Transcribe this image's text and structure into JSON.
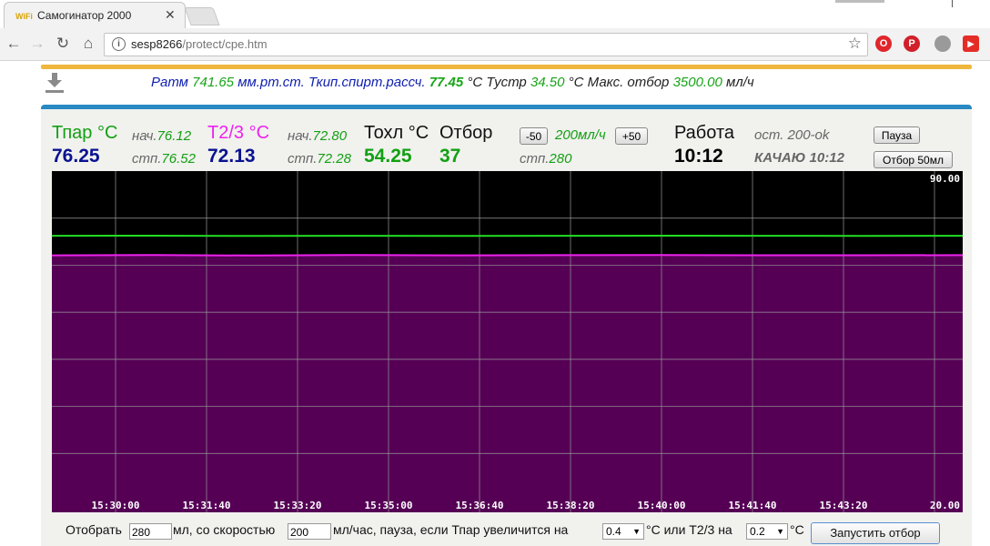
{
  "browser": {
    "tab_title": "Самогинатор 2000",
    "tab_icon_text": "WiFi",
    "url_host": "sesp8266",
    "url_path": "/protect/cpe.htm",
    "extensions": [
      {
        "name": "opera-icon",
        "color": "#e0262b",
        "glyph": "O"
      },
      {
        "name": "pinterest-icon",
        "color": "#d1202a",
        "glyph": "P"
      },
      {
        "name": "globe-icon",
        "color": "#9a9a9a",
        "glyph": ""
      },
      {
        "name": "youtube-icon",
        "color": "#e52d27",
        "glyph": "▶"
      }
    ]
  },
  "status": {
    "patm_label": "Ратм",
    "patm_value": "741.65",
    "patm_unit": "мм.рт.ст.",
    "tkip_label": "Ткип.спирт.рассч.",
    "tkip_value": "77.45",
    "tkip_unit": "°С",
    "tustr_label": "Тустр",
    "tustr_value": "34.50",
    "tustr_unit": "°С",
    "max_label": "Макс. отбор",
    "max_value": "3500.00",
    "max_unit": "мл/ч"
  },
  "sensors": {
    "tpar": {
      "label": "Тпар °С",
      "value": "76.25",
      "nach_label": "нач.",
      "nach_value": "76.12",
      "stp_label": "стп.",
      "stp_value": "76.52"
    },
    "t23": {
      "label": "Т2/3 °С",
      "value": "72.13",
      "nach_label": "нач.",
      "nach_value": "72.80",
      "stp_label": "стп.",
      "stp_value": "72.28"
    },
    "tohl": {
      "label": "Тохл °С",
      "value": "54.25"
    },
    "otbor": {
      "label": "Отбор",
      "value": "37",
      "minus_label": "-50",
      "plus_label": "+50",
      "rate": "200мл/ч",
      "stp_label": "стп.",
      "stp_value": "280"
    },
    "work": {
      "label": "Работа",
      "time": "10:12",
      "ost": "ост. 200-ok",
      "status": "КАЧАЮ 10:12",
      "pause_label": "Пауза",
      "otbor50_label": "Отбор 50мл"
    }
  },
  "chart_data": {
    "type": "line",
    "x": [
      "15:30:00",
      "15:31:40",
      "15:33:20",
      "15:35:00",
      "15:36:40",
      "15:38:20",
      "15:40:00",
      "15:41:40",
      "15:43:20"
    ],
    "ylim": [
      20.0,
      90.0
    ],
    "y_max_label": "90.00",
    "y_min_label": "20.00",
    "grid": true,
    "background": "#000000",
    "fill_color": "#550055",
    "series": [
      {
        "color": "#22dd22",
        "values": [
          76.25,
          76.28,
          76.22,
          76.26,
          76.24,
          76.25,
          76.27,
          76.25,
          76.24,
          76.25
        ]
      },
      {
        "color": "#ee22ee",
        "values": [
          72.1,
          72.15,
          72.05,
          72.18,
          72.1,
          72.13,
          72.15,
          72.12,
          72.11,
          72.13
        ]
      }
    ]
  },
  "controls": {
    "text_otobrat": "Отобрать",
    "amount_value": "280",
    "text_ml_speed": "мл, со скоростью",
    "speed_value": "200",
    "text_pause": "мл/час, пауза, если Тпар увеличится на",
    "tpar_delta": "0.4",
    "text_or": "°С или Т2/3 на",
    "t23_delta": "0.2",
    "text_c": "°С",
    "start_label": "Запустить отбор"
  }
}
